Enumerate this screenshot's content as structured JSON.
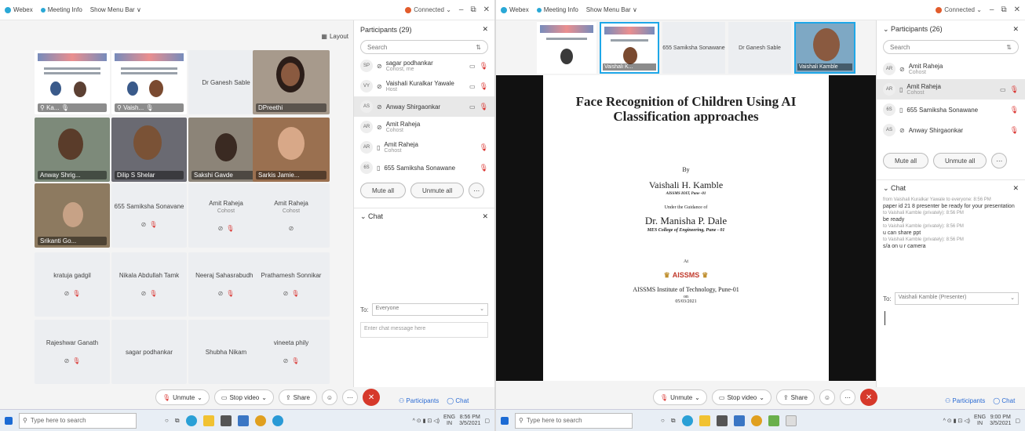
{
  "left": {
    "titlebar": {
      "webex": "Webex",
      "meeting_info": "Meeting Info",
      "show_menu": "Show Menu Bar ∨",
      "connected": "Connected ⌄"
    },
    "layout_btn": "Layout",
    "tiles": [
      {
        "name": "",
        "type": "slide"
      },
      {
        "name": "",
        "type": "slide"
      },
      {
        "name": "Dr Ganesh Sable",
        "type": "name"
      },
      {
        "name": "DPreethi",
        "type": "video"
      },
      {
        "name": "Anway Shrig...",
        "type": "video"
      },
      {
        "name": "Dilip S Shelar",
        "type": "video"
      },
      {
        "name": "Sakshi Gavde",
        "type": "video"
      },
      {
        "name": "Sarkis Jamie...",
        "type": "video"
      },
      {
        "name": "Srikanti Go...",
        "type": "video"
      },
      {
        "name": "655 Samiksha Sonavane",
        "type": "name"
      },
      {
        "name": "Amit Raheja",
        "type": "name",
        "sub": "Cohost"
      },
      {
        "name": "Amit Raheja",
        "type": "name",
        "sub": "Cohost"
      },
      {
        "name": "kratuja gadgil",
        "type": "name"
      },
      {
        "name": "Nikala Abdullah Tamk",
        "type": "name"
      },
      {
        "name": "Neeraj Sahasrabudhe",
        "type": "name"
      },
      {
        "name": "Prathamesh Sonnikar",
        "type": "name"
      },
      {
        "name": "Rajeshwar Ganath",
        "type": "name"
      },
      {
        "name": "sagar podhankar",
        "type": "name"
      },
      {
        "name": "Shubha Nikam",
        "type": "name"
      },
      {
        "name": "vineeta phily",
        "type": "name"
      }
    ],
    "participants": {
      "title": "Participants (29)",
      "search": "Search",
      "rows": [
        {
          "initials": "SP",
          "name": "sagar podhankar",
          "sub": "Cohost, me"
        },
        {
          "initials": "VY",
          "name": "Vaishali Kuralkar Yawale",
          "sub": "Host"
        },
        {
          "initials": "AS",
          "name": "Anway Shirgaonkar",
          "sub": ""
        },
        {
          "initials": "AR",
          "name": "Amit Raheja",
          "sub": "Cohost"
        },
        {
          "initials": "AR",
          "name": "Amit Raheja",
          "sub": "Cohost"
        },
        {
          "initials": "6S",
          "name": "655 Samiksha Sonawane",
          "sub": ""
        }
      ],
      "mute_all": "Mute all",
      "unmute_all": "Unmute all"
    },
    "chat": {
      "title": "Chat",
      "to_label": "To:",
      "to_value": "Everyone",
      "placeholder": "Enter chat message here"
    },
    "toolbar": {
      "unmute": "Unmute",
      "stop_video": "Stop video",
      "share": "Share",
      "participants": "Participants",
      "chat": "Chat"
    }
  },
  "right": {
    "titlebar": {
      "webex": "Webex",
      "meeting_info": "Meeting Info",
      "show_menu": "Show Menu Bar ∨",
      "connected": "Connected ⌄"
    },
    "thumbs": [
      {
        "name": ""
      },
      {
        "name": "Vaishali K..."
      },
      {
        "name": "655 Samiksha Sonawane"
      },
      {
        "name": "Dr Ganesh Sable"
      },
      {
        "name": "Vaishali Kamble"
      }
    ],
    "slide": {
      "title": "Face Recognition of Children Using AI Classification approaches",
      "by": "By",
      "author": "Vaishali H. Kamble",
      "author_affil": "AISSMS IOIT, Pune -01",
      "guidance": "Under the Guidance of",
      "guide": "Dr. Manisha P. Dale",
      "guide_affil": "MES College of Engineering, Pune - 01",
      "at": "At",
      "logo": "AISSMS",
      "institute": "AISSMS Institute of Technology, Pune-01",
      "on": "on",
      "date": "05/03/2021"
    },
    "participants": {
      "title": "Participants (26)",
      "search": "Search",
      "rows": [
        {
          "initials": "AR",
          "name": "Amit Raheja",
          "sub": "Cohost"
        },
        {
          "initials": "AR",
          "name": "Amit Raheja",
          "sub": "Cohost"
        },
        {
          "initials": "6S",
          "name": "655 Samiksha Sonawane",
          "sub": ""
        },
        {
          "initials": "AS",
          "name": "Anway Shirgaonkar",
          "sub": ""
        }
      ],
      "mute_all": "Mute all",
      "unmute_all": "Unmute all"
    },
    "chat": {
      "title": "Chat",
      "messages": [
        {
          "meta": "from Vaishali Kuralkar Yawale to everyone: 8:56 PM",
          "text": "paper id 21 8 presenter be ready for your presentation"
        },
        {
          "meta": "to Vaishali Kamble (privately): 8:56 PM",
          "text": "be ready"
        },
        {
          "meta": "to Vaishali Kamble (privately): 8:56 PM",
          "text": "u can share ppt"
        },
        {
          "meta": "to Vaishali Kamble (privately): 8:56 PM",
          "text": "s/a on u r camera"
        }
      ],
      "to_label": "To:",
      "to_value": "Vaishali Kamble (Presenter)"
    },
    "toolbar": {
      "unmute": "Unmute",
      "stop_video": "Stop video",
      "share": "Share",
      "participants": "Participants",
      "chat": "Chat"
    }
  },
  "taskbar": {
    "search": "Type here to search",
    "lang": "ENG",
    "region": "IN",
    "time_left": "8:56 PM",
    "date_left": "3/5/2021",
    "time_right": "9:00 PM",
    "date_right": "3/5/2021"
  }
}
